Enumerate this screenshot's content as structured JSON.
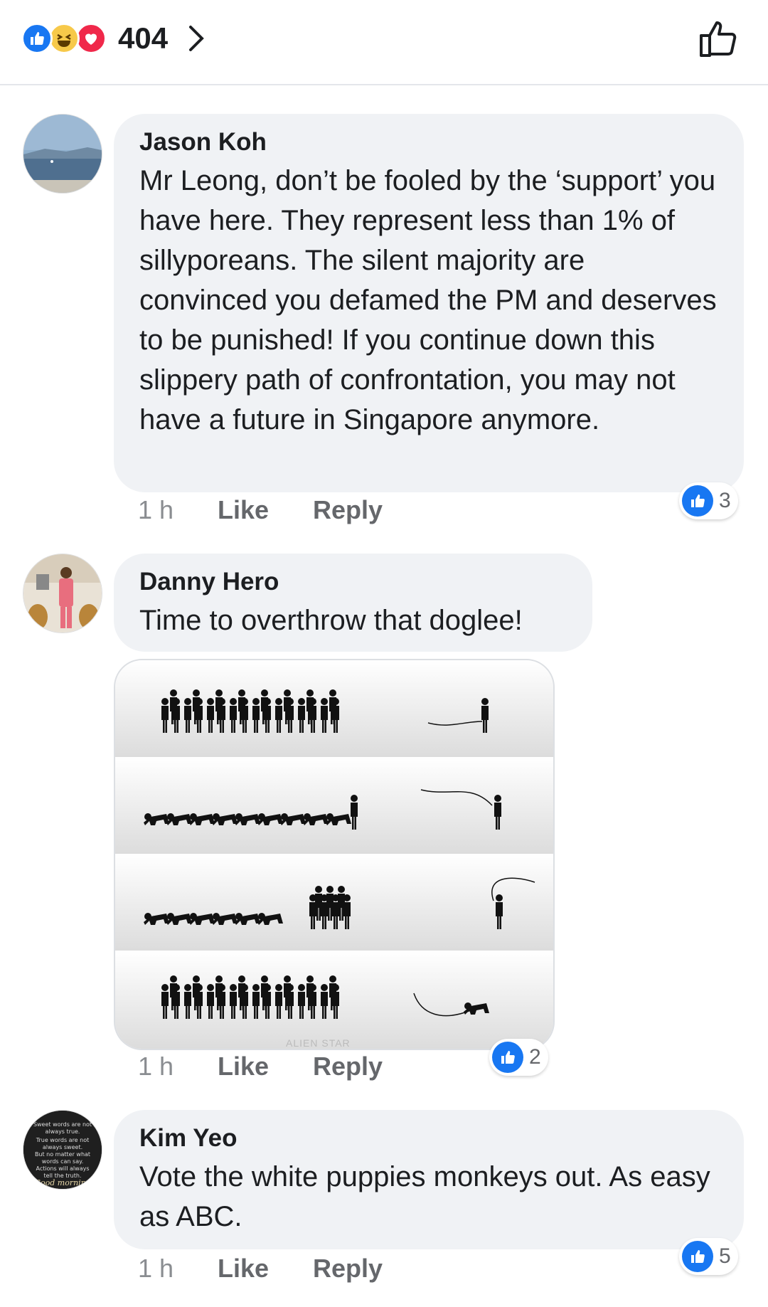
{
  "reactions_bar": {
    "icons": [
      "like-reaction-icon",
      "haha-reaction-icon",
      "love-reaction-icon"
    ],
    "count": "404"
  },
  "colors": {
    "accent": "#1877f2",
    "bubble": "#f0f2f5",
    "meta": "#65676b"
  },
  "comments": [
    {
      "author": "Jason Koh",
      "text": "Mr Leong, don’t be fooled by the ‘support’ you have here. They represent less than 1% of sillyporeans. The silent  majority are convinced you defamed the PM and deserves to be punished! If you continue down this slippery path of confrontation, you may not have a future in Singapore anymore.",
      "time": "1 h",
      "like_label": "Like",
      "reply_label": "Reply",
      "reaction_count": "3"
    },
    {
      "author": "Danny Hero",
      "text": "Time to overthrow that doglee!",
      "time": "1 h",
      "like_label": "Like",
      "reply_label": "Reply",
      "reaction_count": "2",
      "image_watermark": "ALIEN STAR"
    },
    {
      "author": "Kim Yeo",
      "text": "Vote the white puppies monkeys out. As easy as ABC.",
      "time": "1 h",
      "like_label": "Like",
      "reply_label": "Reply",
      "reaction_count": "5",
      "avatar_text": "Sweet words are not always true. True words are not always sweet. But no matter what words can say. Actions will always tell the truth. Good morning"
    }
  ]
}
